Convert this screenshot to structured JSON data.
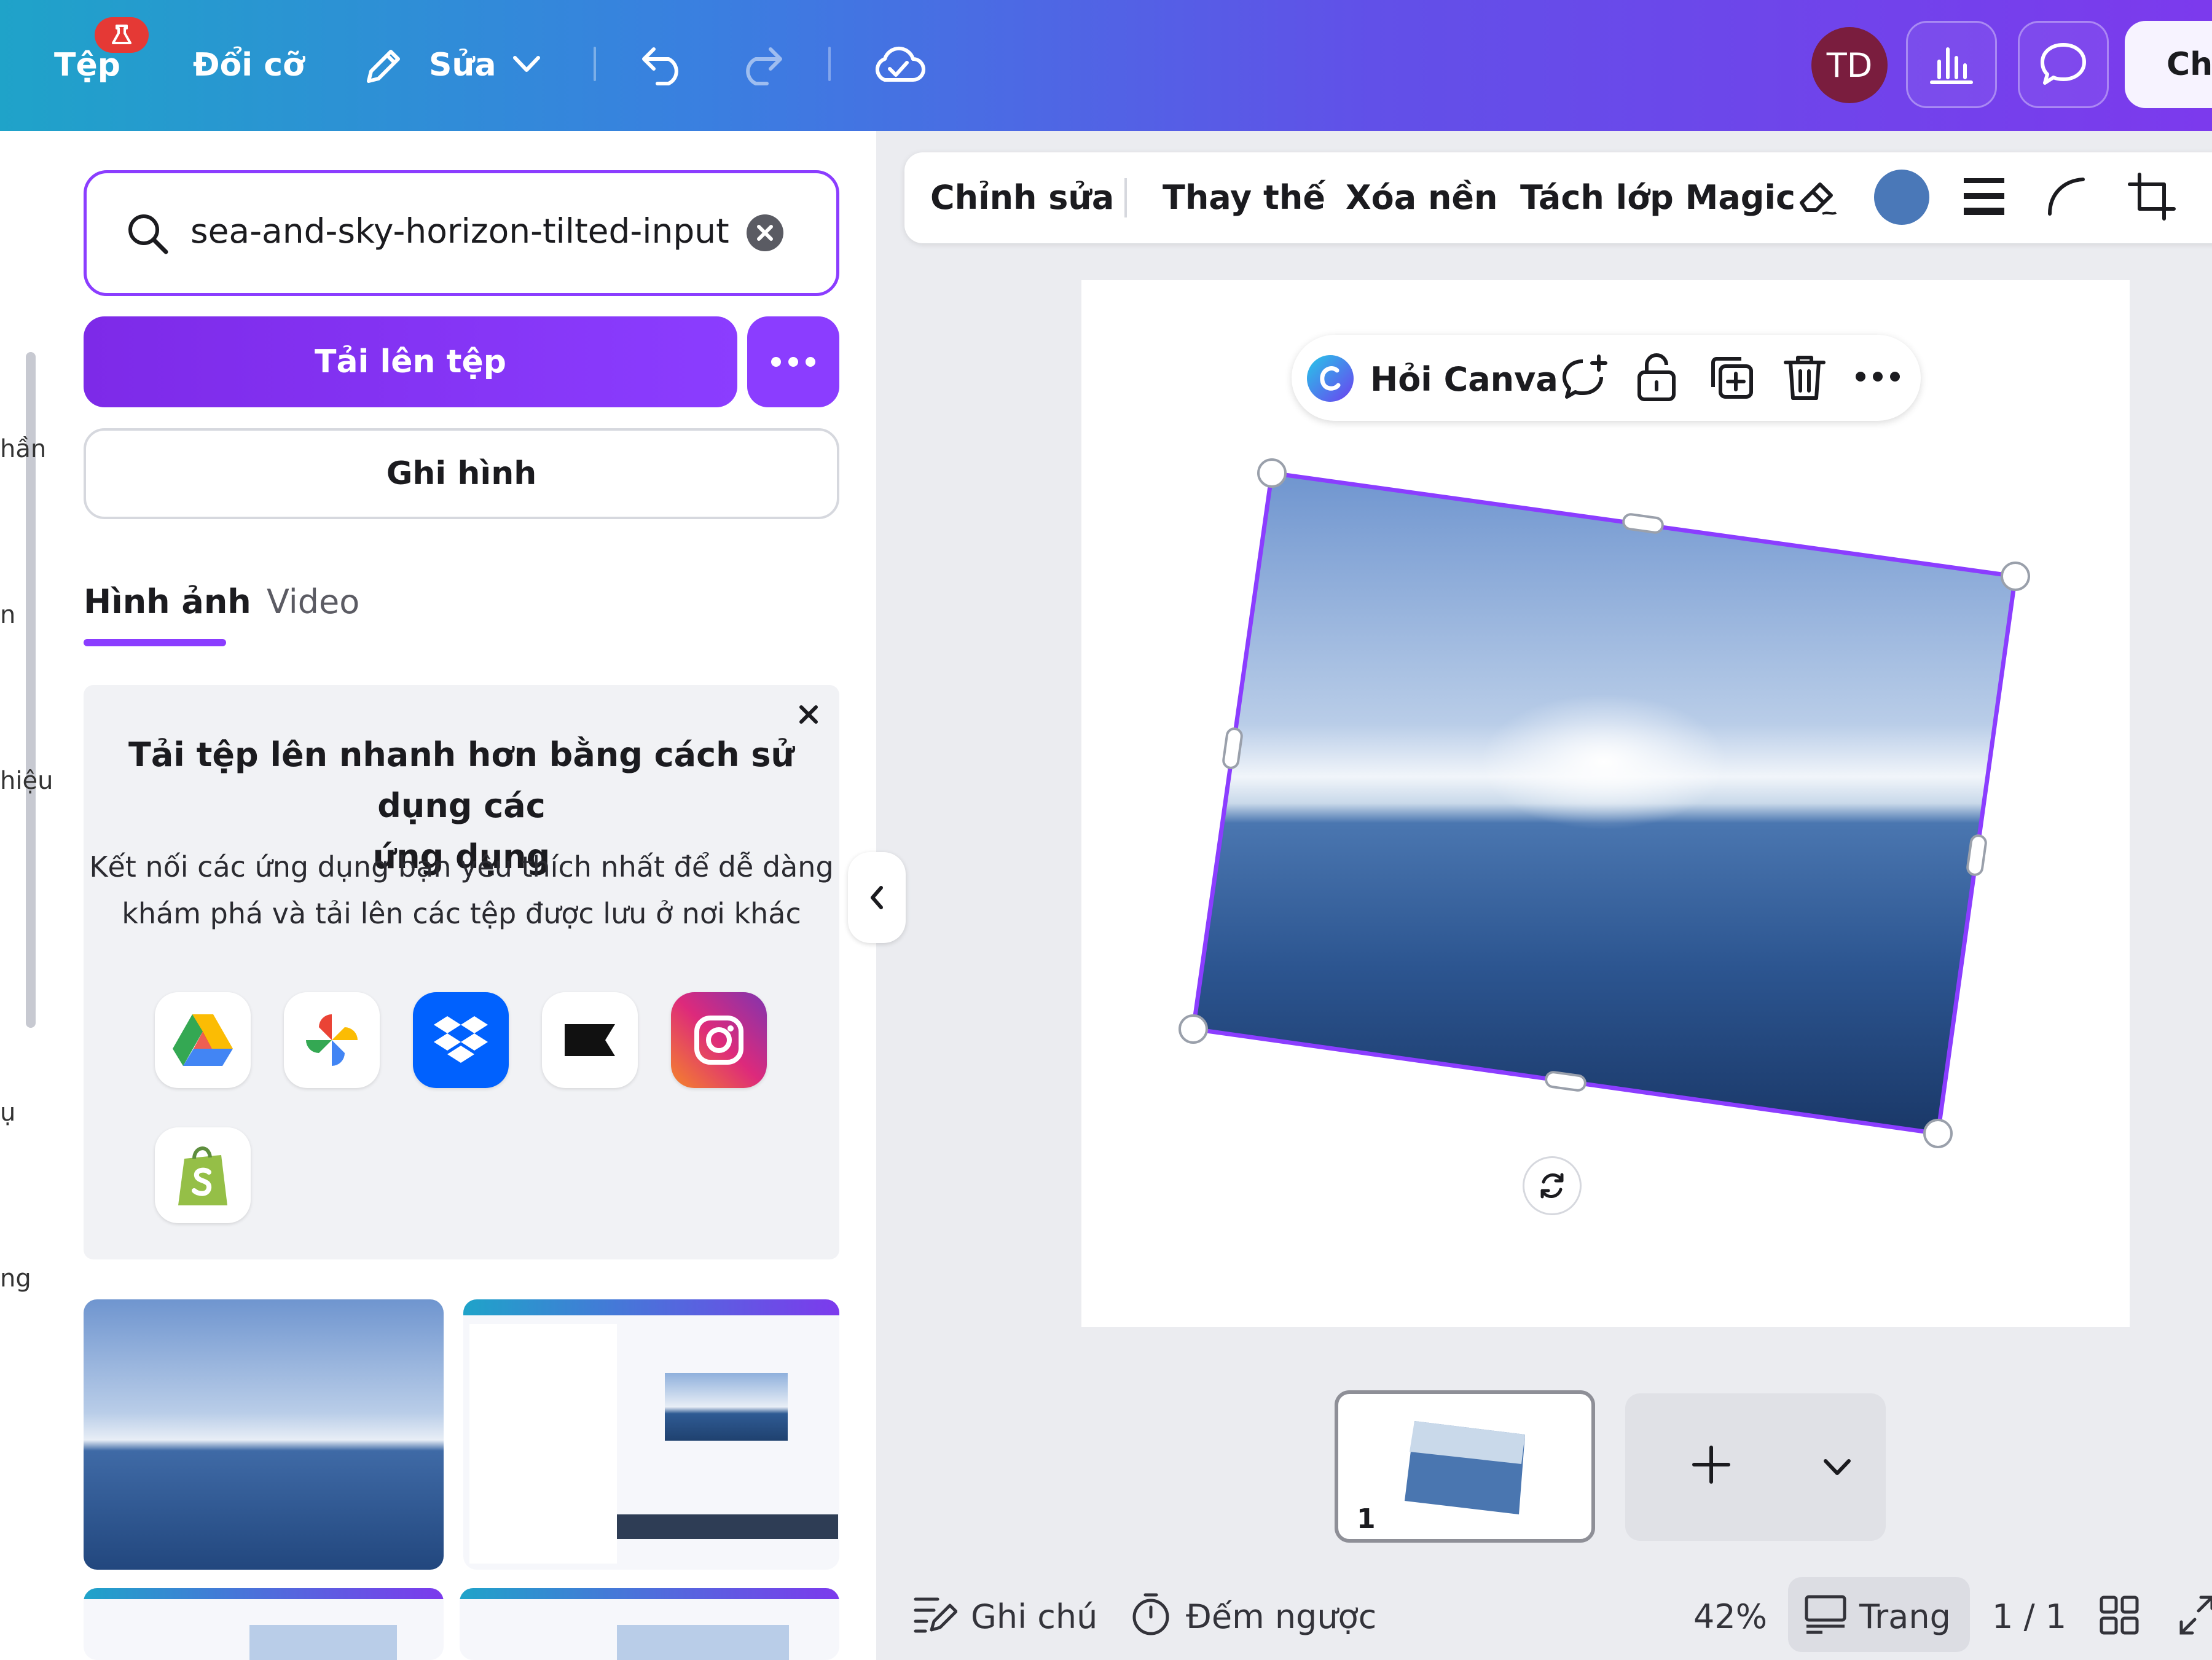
{
  "topbar": {
    "file_label": "Tệp",
    "resize_label": "Đổi cỡ",
    "edit_label": "Sửa",
    "avatar_initials": "TD",
    "share_label": "Chi",
    "gradient_colors": [
      "#1fa3c9",
      "#6150e8",
      "#7c3aed"
    ]
  },
  "rail": {
    "labels": [
      "hần",
      "n",
      "hiệu",
      "ụ",
      "ng"
    ]
  },
  "upload_panel": {
    "search_value": "sea-and-sky-horizon-tilted-input",
    "upload_button": "Tải lên tệp",
    "record_button": "Ghi hình",
    "tabs": [
      {
        "label": "Hình ảnh",
        "active": true
      },
      {
        "label": "Video",
        "active": false
      }
    ],
    "promo": {
      "title_line1": "Tải tệp lên nhanh hơn bằng cách sử dụng các",
      "title_line2": "ứng dụng",
      "body_line1": "Kết nối các ứng dụng bạn yêu thích nhất để dễ dàng",
      "body_line2": "khám phá và tải lên các tệp được lưu ở nơi khác",
      "apps": [
        "google-drive-icon",
        "google-photos-icon",
        "dropbox-icon",
        "box-icon",
        "instagram-icon",
        "shopify-icon"
      ]
    }
  },
  "context_toolbar": {
    "edit": "Chỉnh sửa",
    "replace": "Thay thế",
    "bg_remove": "Xóa nền",
    "magic_grab": "Tách lớp Magic",
    "swatch_color": "#4a78b8"
  },
  "float_toolbar": {
    "ask_canva": "Hỏi Canva"
  },
  "pages": {
    "thumbnail_number": "1"
  },
  "footer": {
    "notes": "Ghi chú",
    "timer": "Đếm ngược",
    "zoom": "42%",
    "pages_label": "Trang",
    "page_count": "1 / 1"
  },
  "accent_color": "#8b3dff"
}
